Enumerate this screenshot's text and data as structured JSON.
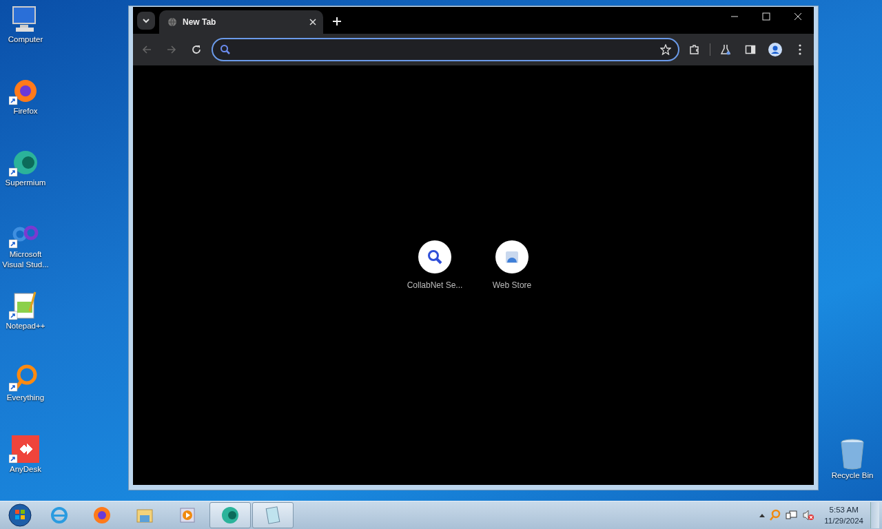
{
  "desktop_icons": [
    {
      "label": "Computer",
      "kind": "computer",
      "shortcut": false
    },
    {
      "label": "Firefox",
      "kind": "firefox",
      "shortcut": true
    },
    {
      "label": "Supermium",
      "kind": "supermium",
      "shortcut": true
    },
    {
      "label": "Microsoft Visual Stud...",
      "kind": "vs",
      "shortcut": true
    },
    {
      "label": "Notepad++",
      "kind": "notepad",
      "shortcut": true
    },
    {
      "label": "Everything",
      "kind": "everything",
      "shortcut": true
    },
    {
      "label": "AnyDesk",
      "kind": "anydesk",
      "shortcut": true
    }
  ],
  "recycle_bin": {
    "label": "Recycle Bin"
  },
  "browser": {
    "tabs": [
      {
        "title": "New Tab",
        "selected": true
      }
    ],
    "shortcuts": [
      {
        "label": "CollabNet Se...",
        "kind": "search"
      },
      {
        "label": "Web Store",
        "kind": "store"
      }
    ]
  },
  "taskbar": {
    "apps": [
      {
        "kind": "ie",
        "active": false
      },
      {
        "kind": "firefox",
        "active": false
      },
      {
        "kind": "explorer",
        "active": false
      },
      {
        "kind": "media",
        "active": false
      },
      {
        "kind": "supermium",
        "active": true
      },
      {
        "kind": "notepad",
        "active": true
      }
    ],
    "clock": {
      "time": "5:53 AM",
      "date": "11/29/2024"
    }
  }
}
